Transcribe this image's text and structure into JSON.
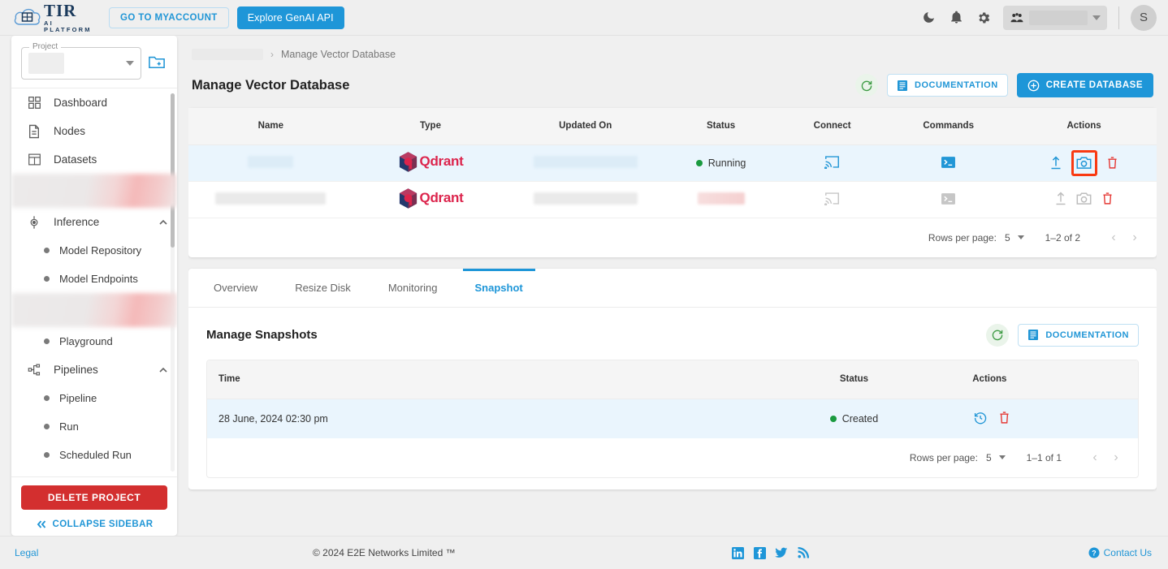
{
  "topbar": {
    "brand_name": "TIR",
    "brand_tagline": "AI PLATFORM",
    "myaccount_label": "GO TO MYACCOUNT",
    "genai_label": "Explore GenAI API",
    "dark_mode_icon": "moon-icon",
    "notifications_icon": "bell-icon",
    "settings_icon": "gear-icon",
    "team_icon": "team-icon",
    "avatar_initial": "S"
  },
  "sidebar": {
    "project_label": "Project",
    "project_value": "",
    "new_project_icon": "new-folder-icon",
    "items": [
      {
        "label": "Dashboard",
        "icon": "dashboard-icon",
        "type": "item"
      },
      {
        "label": "Nodes",
        "icon": "nodes-icon",
        "type": "item"
      },
      {
        "label": "Datasets",
        "icon": "datasets-icon",
        "type": "item"
      },
      {
        "label": "",
        "icon": "",
        "type": "redacted"
      },
      {
        "label": "Inference",
        "icon": "inference-icon",
        "type": "group",
        "expanded": true
      },
      {
        "label": "Model Repository",
        "type": "sub"
      },
      {
        "label": "Model Endpoints",
        "type": "sub"
      },
      {
        "label": "",
        "type": "redacted"
      },
      {
        "label": "Playground",
        "type": "sub"
      },
      {
        "label": "Pipelines",
        "icon": "pipelines-icon",
        "type": "group",
        "expanded": true
      },
      {
        "label": "Pipeline",
        "type": "sub"
      },
      {
        "label": "Run",
        "type": "sub"
      },
      {
        "label": "Scheduled Run",
        "type": "sub"
      }
    ],
    "delete_project_label": "DELETE PROJECT",
    "collapse_label": "COLLAPSE SIDEBAR",
    "collapse_icon": "double-chevron-left-icon"
  },
  "main": {
    "breadcrumb": {
      "parent": "",
      "current": "Manage Vector Database",
      "separator": "›"
    },
    "page_title": "Manage Vector Database",
    "refresh_icon": "refresh-icon",
    "documentation_label": "DOCUMENTATION",
    "documentation_icon": "document-icon",
    "create_label": "CREATE DATABASE",
    "create_icon": "plus-circle-icon",
    "table": {
      "columns": [
        "Name",
        "Type",
        "Updated On",
        "Status",
        "Connect",
        "Commands",
        "Actions"
      ],
      "rows": [
        {
          "name": "",
          "type": "Qdrant",
          "updated_on": "",
          "status": "Running",
          "status_color": "#1a9a3f",
          "connect_icon": "cast-connect-icon",
          "commands_icon": "terminal-icon",
          "actions": [
            "upload-icon",
            "camera-snapshot-icon",
            "delete-icon"
          ],
          "selected": true,
          "enabled": true,
          "highlighted_action": "camera-snapshot-icon"
        },
        {
          "name": "",
          "type": "Qdrant",
          "updated_on": "",
          "status": "",
          "status_color": "#f0d4d4",
          "connect_icon": "cast-connect-icon",
          "commands_icon": "terminal-icon",
          "actions": [
            "upload-icon",
            "camera-snapshot-icon",
            "delete-icon"
          ],
          "selected": false,
          "enabled": false,
          "highlighted_action": ""
        }
      ],
      "pagination": {
        "rows_per_page_label": "Rows per page:",
        "rows_per_page_value": "5",
        "range": "1–2 of 2",
        "prev_icon": "chevron-left-icon",
        "next_icon": "chevron-right-icon"
      }
    },
    "tabs": [
      {
        "label": "Overview",
        "active": false
      },
      {
        "label": "Resize Disk",
        "active": false
      },
      {
        "label": "Monitoring",
        "active": false
      },
      {
        "label": "Snapshot",
        "active": true
      }
    ],
    "snapshots": {
      "title": "Manage Snapshots",
      "refresh_icon": "refresh-icon",
      "documentation_label": "DOCUMENTATION",
      "documentation_icon": "document-icon",
      "columns": [
        "Time",
        "Status",
        "Actions"
      ],
      "rows": [
        {
          "time": "28 June, 2024 02:30 pm",
          "status": "Created",
          "status_color": "#1a9a3f",
          "actions": [
            "restore-icon",
            "delete-icon"
          ]
        }
      ],
      "pagination": {
        "rows_per_page_label": "Rows per page:",
        "rows_per_page_value": "5",
        "range": "1–1 of 1",
        "prev_icon": "chevron-left-icon",
        "next_icon": "chevron-right-icon"
      }
    }
  },
  "footer": {
    "legal": "Legal",
    "copyright": "© 2024 E2E Networks Limited ™",
    "social": [
      "linkedin-icon",
      "facebook-icon",
      "twitter-icon",
      "rss-icon"
    ],
    "contact": "Contact Us",
    "contact_icon": "help-circle-icon"
  },
  "colors": {
    "accent": "#1e96d8",
    "danger": "#d32f2f",
    "highlight": "#f93a12",
    "success": "#1a9a3f",
    "row_selected": "#eaf5fd"
  }
}
